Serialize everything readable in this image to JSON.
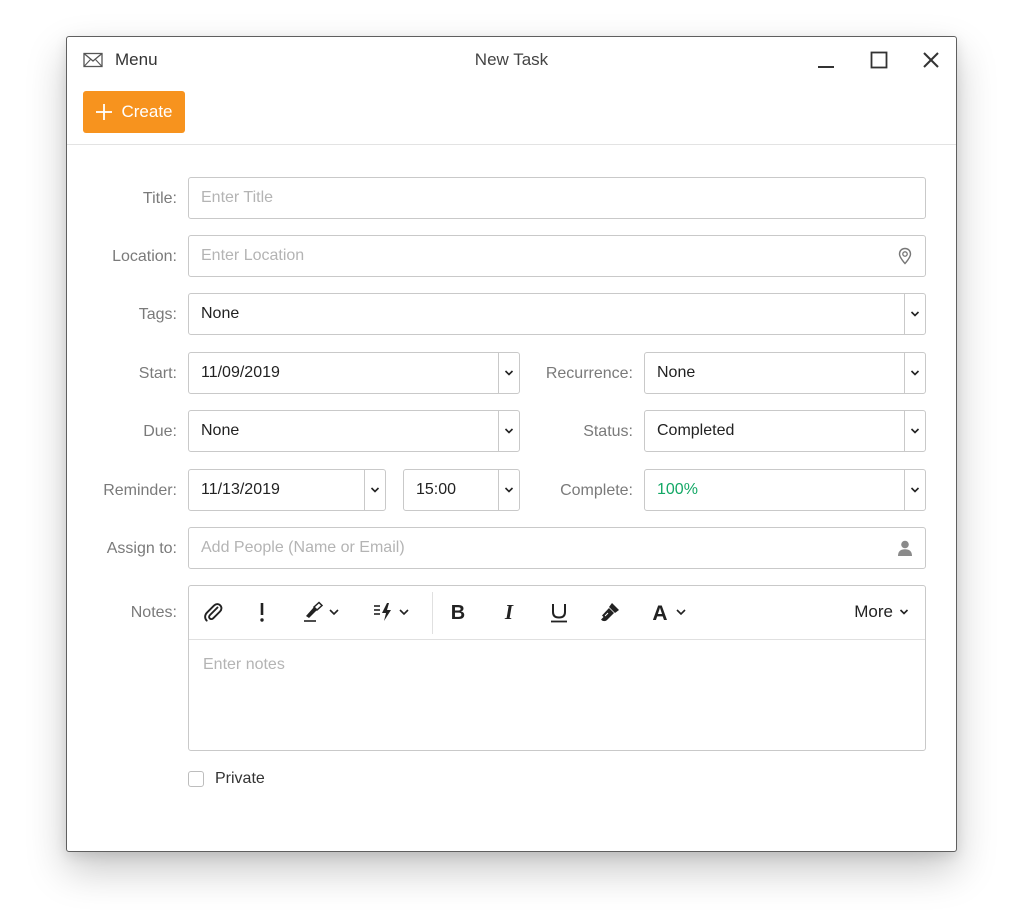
{
  "window": {
    "menu_label": "Menu",
    "title": "New Task"
  },
  "toolbar": {
    "create_label": "Create"
  },
  "form": {
    "title_label": "Title:",
    "title_placeholder": "Enter Title",
    "location_label": "Location:",
    "location_placeholder": "Enter Location",
    "tags_label": "Tags:",
    "tags_value": "None",
    "start_label": "Start:",
    "start_value": "11/09/2019",
    "recurrence_label": "Recurrence:",
    "recurrence_value": "None",
    "due_label": "Due:",
    "due_value": "None",
    "status_label": "Status:",
    "status_value": "Completed",
    "reminder_label": "Reminder:",
    "reminder_date": "11/13/2019",
    "reminder_time": "15:00",
    "complete_label": "Complete:",
    "complete_value": "100%",
    "assign_label": "Assign to:",
    "assign_placeholder": "Add People (Name or Email)",
    "notes_label": "Notes:",
    "notes_placeholder": "Enter notes",
    "more_label": "More",
    "private_label": "Private",
    "private_checked": false
  },
  "colors": {
    "accent": "#f7931e",
    "complete_text": "#13a866"
  }
}
